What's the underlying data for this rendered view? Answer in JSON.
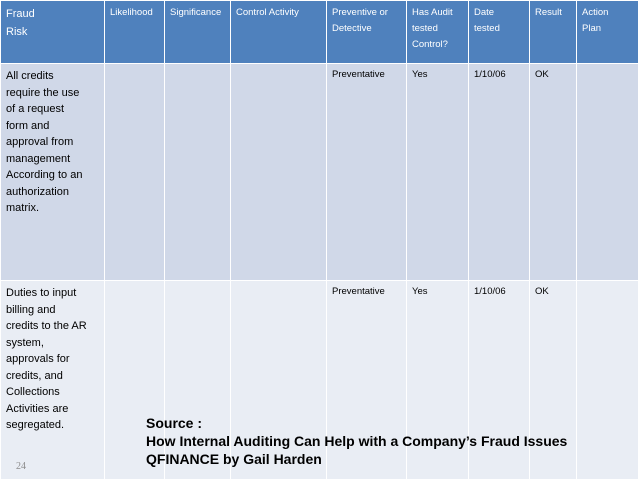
{
  "header": {
    "fraud_risk": "Fraud\nRisk",
    "likelihood": "Likelihood",
    "significance": "Significance",
    "control_activity": "Control Activity",
    "preventive_or_detective": "Preventive or\nDetective",
    "has_audit_tested_control": "Has Audit\ntested\nControl?",
    "date_tested": "Date\ntested",
    "result": "Result",
    "action_plan": "Action\nPlan"
  },
  "rows": [
    {
      "fraud_risk": "All credits\nrequire the use\nof a request\nform and\napproval from\nmanagement\nAccording to an\nauthorization\nmatrix.",
      "likelihood": "",
      "significance": "",
      "control_activity": "",
      "preventive_or_detective": "Preventative",
      "has_audit_tested_control": "Yes",
      "date_tested": "1/10/06",
      "result": "OK",
      "action_plan": ""
    },
    {
      "fraud_risk": "Duties to input\nbilling and\ncredits to the AR\nsystem,\napprovals for\ncredits, and\nCollections\nActivities are\nsegregated.",
      "likelihood": "",
      "significance": "",
      "control_activity": "",
      "preventive_or_detective": "Preventative",
      "has_audit_tested_control": "Yes",
      "date_tested": "1/10/06",
      "result": "OK",
      "action_plan": ""
    }
  ],
  "footnote": {
    "line1": "Source :",
    "line2": "How Internal Auditing Can Help with a Company’s Fraud Issues",
    "line3": "QFINANCE by Gail Harden"
  },
  "page_number": "24",
  "colors": {
    "header_fill": "#4f81bd",
    "row_fill_1": "#d0d8e8",
    "row_fill_2": "#e9edf4",
    "page_number": "#8c8c8c"
  }
}
